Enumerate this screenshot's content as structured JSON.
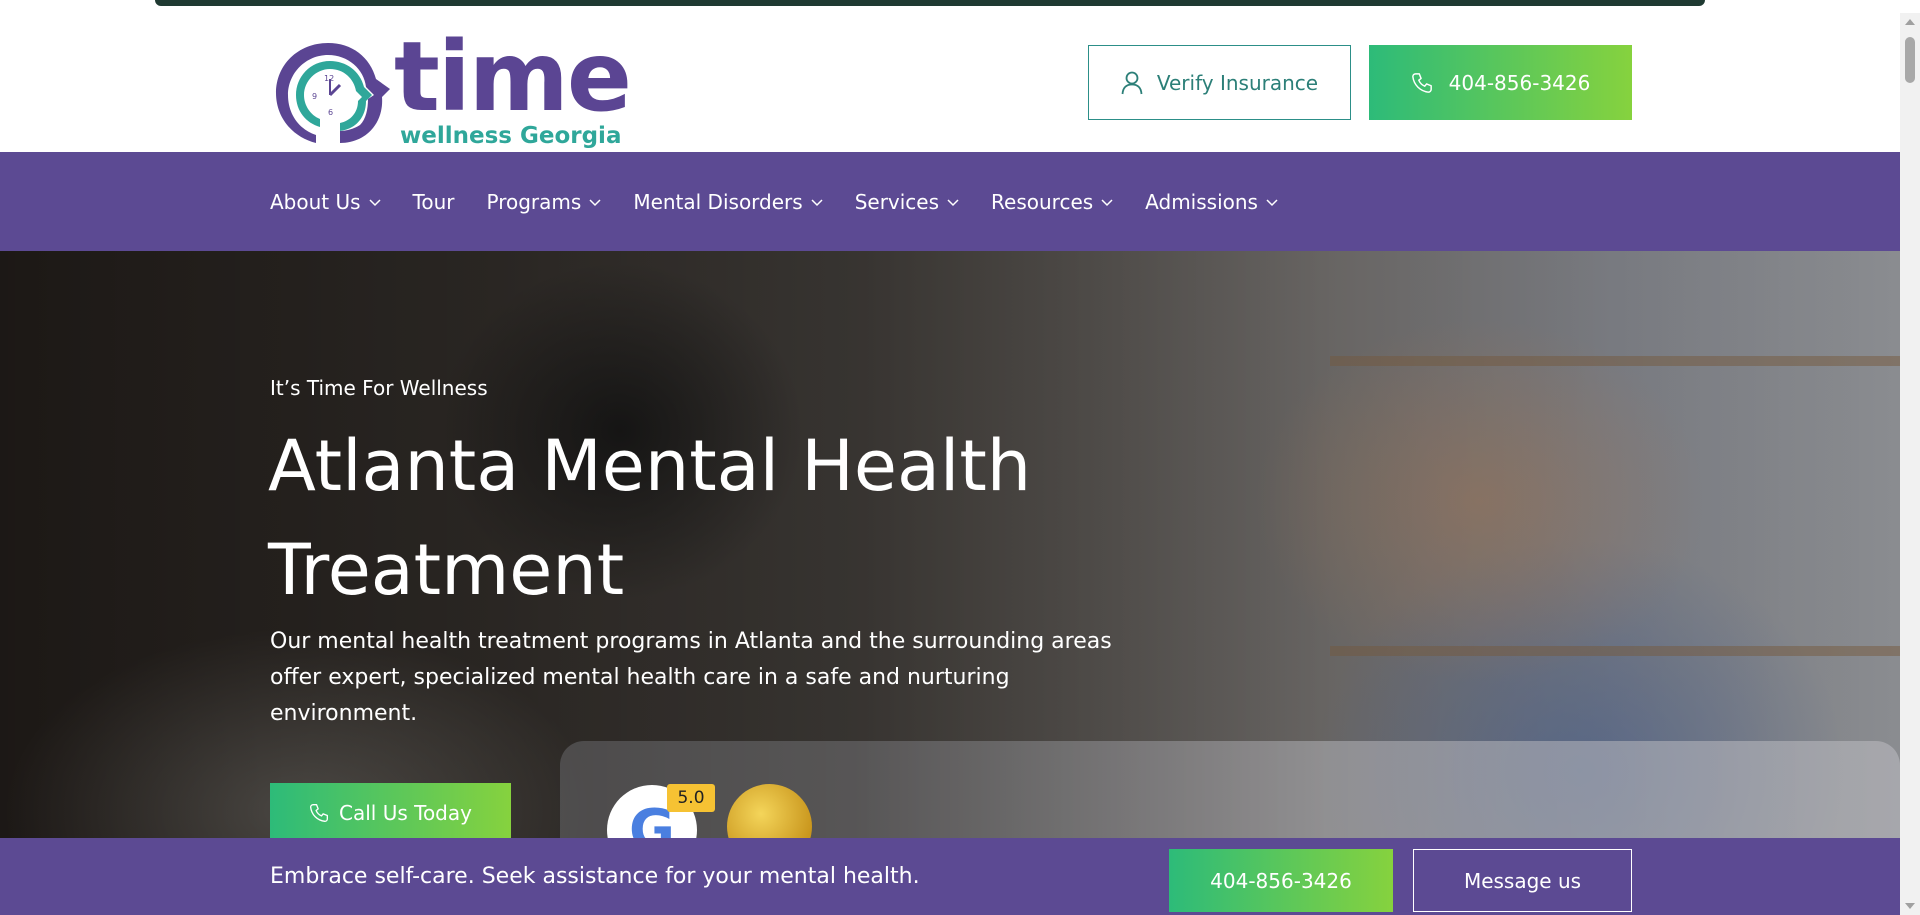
{
  "brand": {
    "name": "time",
    "tagline": "wellness Georgia",
    "primary_color": "#5c4a93",
    "accent_color": "#2fa79a",
    "cta_gradient": [
      "#2dbb79",
      "#86d23e"
    ]
  },
  "header": {
    "verify_label": "Verify Insurance",
    "verify_icon": "user-icon",
    "phone_label": "404-856-3426",
    "phone_icon": "phone-icon"
  },
  "nav": {
    "items": [
      {
        "label": "About Us",
        "dropdown": true
      },
      {
        "label": "Tour",
        "dropdown": false
      },
      {
        "label": "Programs",
        "dropdown": true
      },
      {
        "label": "Mental Disorders",
        "dropdown": true
      },
      {
        "label": "Services",
        "dropdown": true
      },
      {
        "label": "Resources",
        "dropdown": true
      },
      {
        "label": "Admissions",
        "dropdown": true
      }
    ]
  },
  "hero": {
    "eyebrow": "It’s Time For Wellness",
    "title_line1": "Atlanta Mental Health",
    "title_line2": "Treatment",
    "description": "Our mental health treatment programs in Atlanta and the surrounding areas offer expert, specialized mental health care in a safe and nurturing environment.",
    "cta_label": "Call Us Today",
    "google_rating": "5.0"
  },
  "bottom_bar": {
    "message": "Embrace self-care. Seek assistance for your mental health.",
    "phone_label": "404-856-3426",
    "message_button": "Message us"
  }
}
